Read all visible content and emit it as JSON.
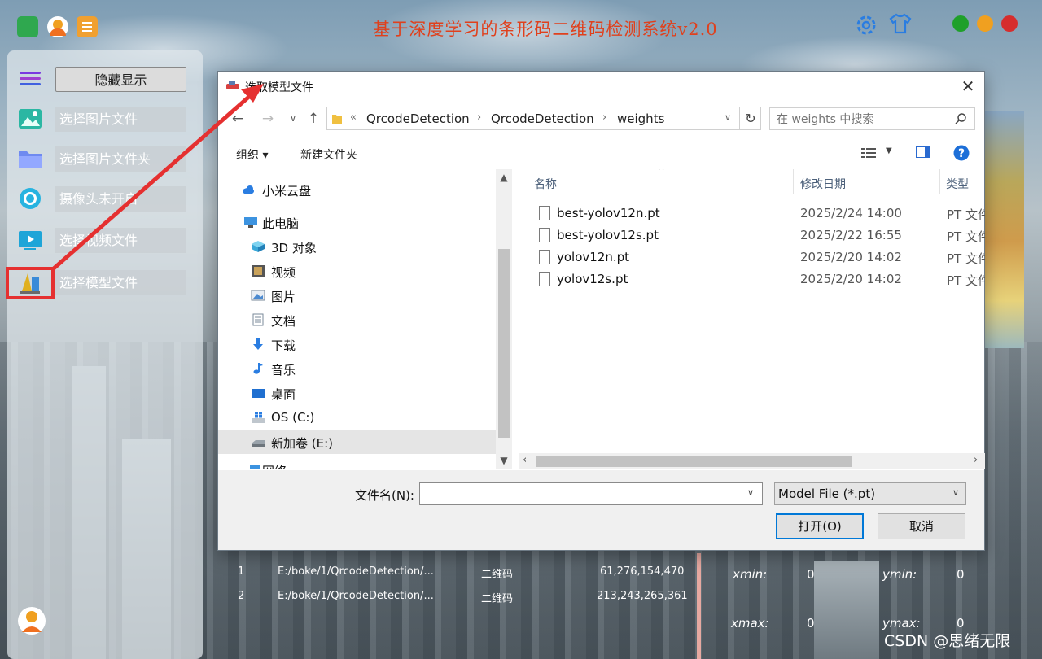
{
  "app": {
    "title": "基于深度学习的条形码二维码检测系统v2.0",
    "colors": {
      "title": "#e0401c",
      "close": "#d62d2d",
      "min": "#f0a020",
      "max": "#1fa02a",
      "accent": "#2a7de1"
    },
    "icons": [
      "logo-icon",
      "user-icon",
      "notes-icon",
      "settings-icon",
      "theme-shirt-icon"
    ]
  },
  "left_panel": {
    "toggle_label": "隐藏显示",
    "items": [
      {
        "label": "选择图片文件",
        "icon": "image-icon"
      },
      {
        "label": "选择图片文件夹",
        "icon": "folder-icon"
      },
      {
        "label": "摄像头未开启",
        "icon": "camera-icon"
      },
      {
        "label": "选择视频文件",
        "icon": "video-icon"
      },
      {
        "label": "选择模型文件",
        "icon": "model-icon"
      }
    ]
  },
  "results": {
    "rows": [
      {
        "index": "1",
        "path": "E:/boke/1/QrcodeDetection/...",
        "type": "二维码",
        "coords": "61,276,154,470"
      },
      {
        "index": "2",
        "path": "E:/boke/1/QrcodeDetection/...",
        "type": "二维码",
        "coords": "213,243,265,361"
      }
    ],
    "xmin_label": "xmin:",
    "xmin": "0",
    "ymin_label": "ymin:",
    "ymin": "0",
    "xmax_label": "xmax:",
    "xmax": "0",
    "ymax_label": "ymax:",
    "ymax": "0"
  },
  "watermark": "CSDN @思绪无限",
  "dialog": {
    "title": "选取模型文件",
    "address": {
      "overflow": "«",
      "segments": [
        "QrcodeDetection",
        "QrcodeDetection",
        "weights"
      ]
    },
    "search_placeholder": "在 weights 中搜索",
    "toolbar": {
      "organize": "组织 ▾",
      "new_folder": "新建文件夹"
    },
    "nav": [
      {
        "label": "小米云盘",
        "icon": "cloud-icon"
      },
      {
        "label": "此电脑",
        "icon": "computer-icon"
      },
      {
        "label": "3D 对象",
        "icon": "cube-icon"
      },
      {
        "label": "视频",
        "icon": "film-icon"
      },
      {
        "label": "图片",
        "icon": "picture-icon"
      },
      {
        "label": "文档",
        "icon": "document-icon"
      },
      {
        "label": "下载",
        "icon": "download-icon"
      },
      {
        "label": "音乐",
        "icon": "music-icon"
      },
      {
        "label": "桌面",
        "icon": "desktop-icon"
      },
      {
        "label": "OS (C:)",
        "icon": "windows-drive-icon"
      },
      {
        "label": "新加卷 (E:)",
        "icon": "drive-icon"
      },
      {
        "label": "网络",
        "icon": "network-icon"
      }
    ],
    "columns": {
      "name": "名称",
      "date": "修改日期",
      "type": "类型"
    },
    "files": [
      {
        "name": "best-yolov12n.pt",
        "date": "2025/2/24 14:00",
        "type": "PT 文件"
      },
      {
        "name": "best-yolov12s.pt",
        "date": "2025/2/22 16:55",
        "type": "PT 文件"
      },
      {
        "name": "yolov12n.pt",
        "date": "2025/2/20 14:02",
        "type": "PT 文件"
      },
      {
        "name": "yolov12s.pt",
        "date": "2025/2/20 14:02",
        "type": "PT 文件"
      }
    ],
    "filename_label": "文件名(N):",
    "filename_value": "",
    "filter_value": "Model File (*.pt)",
    "open_label": "打开(O)",
    "cancel_label": "取消"
  }
}
